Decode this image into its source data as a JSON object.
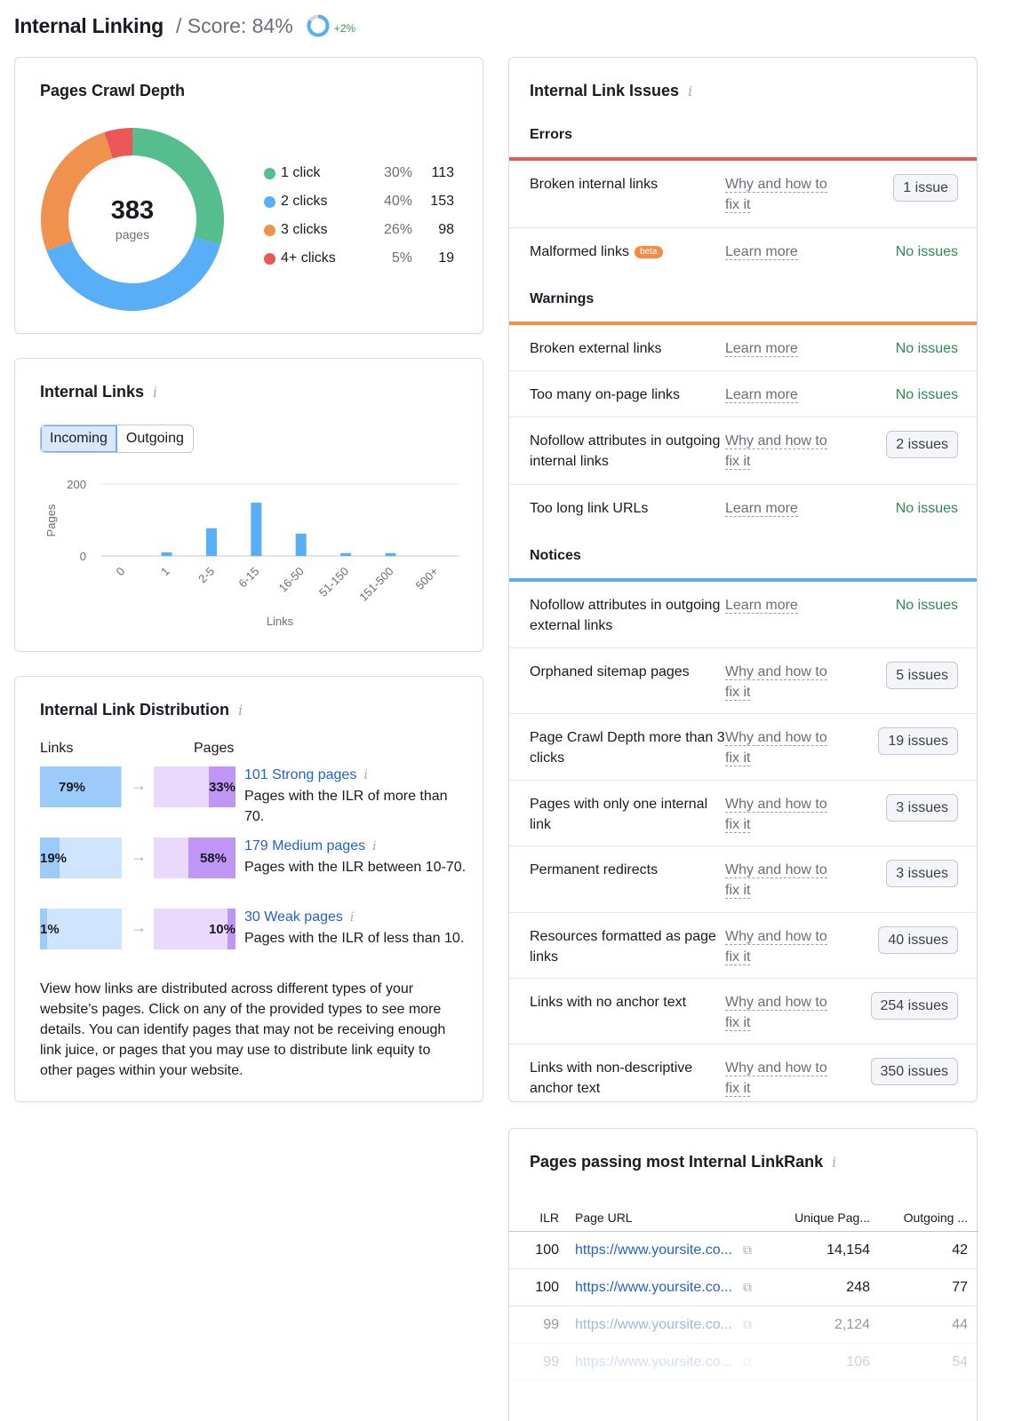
{
  "header": {
    "title": "Internal Linking",
    "score_label": "/ Score: 84%",
    "score_value": 84,
    "score_delta": "+2%"
  },
  "colors": {
    "green": "#56bd8f",
    "blue": "#58aef7",
    "orange": "#f0914e",
    "red": "#eb5757",
    "link": "#2463c6",
    "ok": "#2c8a57"
  },
  "crawl_depth": {
    "title": "Pages Crawl Depth",
    "total": "383",
    "total_unit": "pages",
    "items": [
      {
        "label": "1 click",
        "pct": "30%",
        "count": "113",
        "value": 113,
        "color": "#56bd8f"
      },
      {
        "label": "2 clicks",
        "pct": "40%",
        "count": "153",
        "value": 153,
        "color": "#58aef7"
      },
      {
        "label": "3 clicks",
        "pct": "26%",
        "count": "98",
        "value": 98,
        "color": "#f0914e"
      },
      {
        "label": "4+ clicks",
        "pct": "5%",
        "count": "19",
        "value": 19,
        "color": "#eb5757"
      }
    ]
  },
  "internal_links": {
    "title": "Internal Links",
    "tabs": [
      "Incoming",
      "Outgoing"
    ],
    "active_tab": "Incoming"
  },
  "chart_data": {
    "type": "bar",
    "title": "Internal Links",
    "xlabel": "Links",
    "ylabel": "Pages",
    "categories": [
      "0",
      "1",
      "2-5",
      "6-15",
      "16-50",
      "51-150",
      "151-500",
      "500+"
    ],
    "values": [
      0,
      10,
      77,
      148,
      62,
      8,
      8,
      0
    ],
    "ylim": [
      0,
      200
    ],
    "yticks": [
      "0",
      "200"
    ],
    "grid": true,
    "color": "#58aef7"
  },
  "distribution": {
    "title": "Internal Link Distribution",
    "links_header": "Links",
    "pages_header": "Pages",
    "rows": [
      {
        "links_pct": "79%",
        "links_value": 79,
        "pages_pct": "33%",
        "pages_value": 33,
        "link": "101 Strong pages",
        "desc": "Pages with the ILR of more than 70."
      },
      {
        "links_pct": "19%",
        "links_value": 19,
        "pages_pct": "58%",
        "pages_value": 58,
        "link": "179 Medium pages",
        "desc": "Pages with the ILR between 10-70."
      },
      {
        "links_pct": "1%",
        "links_value": 1,
        "pages_pct": "10%",
        "pages_value": 10,
        "link": "30 Weak pages",
        "desc": "Pages with the ILR of less than 10."
      }
    ],
    "note": "View how links are distributed across different types of your website's pages. Click on any of the provided types to see more details. You can identify pages that may not be receiving enough link juice, or pages that you may use to distribute link equity to other pages within your website."
  },
  "issues": {
    "title": "Internal Link Issues",
    "groups": [
      {
        "name": "Errors",
        "color": "#eb5757",
        "rows": [
          {
            "name": "Broken internal links",
            "link": "Why and how to fix it",
            "status": "1 issue",
            "type": "count"
          },
          {
            "name": "Malformed links",
            "badge": "beta",
            "link": "Learn more",
            "status": "No issues",
            "type": "ok"
          }
        ]
      },
      {
        "name": "Warnings",
        "color": "#f0914e",
        "rows": [
          {
            "name": "Broken external links",
            "link": "Learn more",
            "status": "No issues",
            "type": "ok"
          },
          {
            "name": "Too many on-page links",
            "link": "Learn more",
            "status": "No issues",
            "type": "ok"
          },
          {
            "name": "Nofollow attributes in outgoing internal links",
            "link": "Why and how to fix it",
            "status": "2 issues",
            "type": "count"
          },
          {
            "name": "Too long link URLs",
            "link": "Learn more",
            "status": "No issues",
            "type": "ok"
          }
        ]
      },
      {
        "name": "Notices",
        "color": "#58aef7",
        "rows": [
          {
            "name": "Nofollow attributes in outgoing external links",
            "link": "Learn more",
            "status": "No issues",
            "type": "ok"
          },
          {
            "name": "Orphaned sitemap pages",
            "link": "Why and how to fix it",
            "status": "5 issues",
            "type": "count"
          },
          {
            "name": "Page Crawl Depth more than 3 clicks",
            "link": "Why and how to fix it",
            "status": "19 issues",
            "type": "count"
          },
          {
            "name": "Pages with only one internal link",
            "link": "Why and how to fix it",
            "status": "3 issues",
            "type": "count"
          },
          {
            "name": "Permanent redirects",
            "link": "Why and how to fix it",
            "status": "3 issues",
            "type": "count"
          },
          {
            "name": "Resources formatted as page links",
            "link": "Why and how to fix it",
            "status": "40 issues",
            "type": "count"
          },
          {
            "name": "Links with no anchor text",
            "link": "Why and how to fix it",
            "status": "254 issues",
            "type": "count"
          },
          {
            "name": "Links with non-descriptive anchor text",
            "link": "Why and how to fix it",
            "status": "350 issues",
            "type": "count"
          }
        ]
      }
    ]
  },
  "linkrank": {
    "title": "Pages passing most Internal LinkRank",
    "columns": [
      "ILR",
      "Page URL",
      "Unique Pag...",
      "Outgoing ..."
    ],
    "rows": [
      {
        "ilr": "100",
        "url": "https://www.yoursite.co...",
        "unique": "14,154",
        "outgoing": "42"
      },
      {
        "ilr": "100",
        "url": "https://www.yoursite.co...",
        "unique": "248",
        "outgoing": "77"
      },
      {
        "ilr": "99",
        "url": "https://www.yoursite.co...",
        "unique": "2,124",
        "outgoing": "44"
      },
      {
        "ilr": "99",
        "url": "https://www.yoursite.co...",
        "unique": "106",
        "outgoing": "54"
      }
    ]
  }
}
